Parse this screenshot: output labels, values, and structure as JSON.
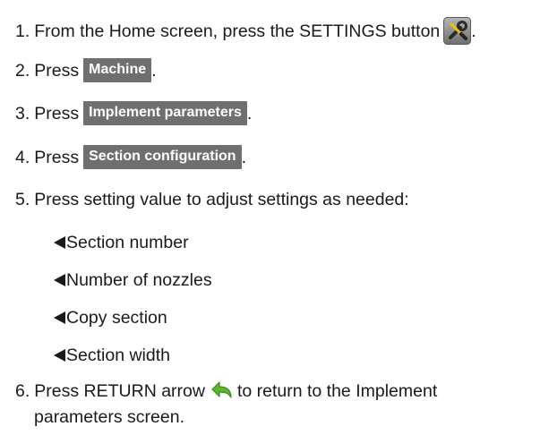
{
  "steps": [
    {
      "num": "1.",
      "text": "From the Home screen, press the SETTINGS button",
      "icon": "settings-tools-icon",
      "after": "."
    },
    {
      "num": "2.",
      "text": "Press",
      "button": "Machine",
      "after": "."
    },
    {
      "num": "3.",
      "text": "Press",
      "button": "Implement parameters",
      "after": "."
    },
    {
      "num": "4.",
      "text": "Press",
      "button": "Section configuration",
      "after": "."
    },
    {
      "num": "5.",
      "text": "Press setting value to adjust settings as needed:"
    },
    {
      "num": "6.",
      "text_before": "Press RETURN arrow",
      "icon": "return-arrow-icon",
      "text_after": "to return to the Implement",
      "continuation": "parameters screen."
    }
  ],
  "settings_list": [
    "Section number",
    "Number of nozzles",
    "Copy section",
    "Section width"
  ],
  "colors": {
    "button_bg": "#6f6f6f",
    "button_text": "#ffffff",
    "return_arrow": "#5cb82e",
    "settings_icon_bg": "#8a8a8a"
  }
}
